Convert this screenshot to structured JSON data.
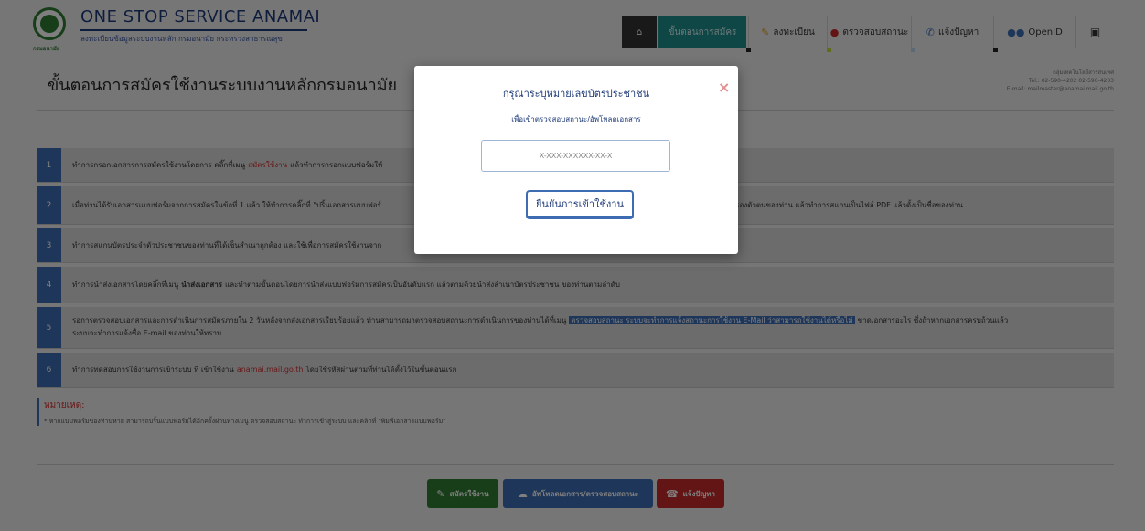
{
  "header": {
    "logo_caption": "กรมอนามัย",
    "title": "ONE STOP SERVICE ANAMAI",
    "subtitle": "ลงทะเบียนข้อมูลระบบงานหลัก กรมอนามัย กระทรวงสาธารณสุข",
    "nav": {
      "home_icon": "home-icon",
      "steps_label": "ขั้นตอนการสมัคร",
      "register_label": "ลงทะเบียน",
      "check_label": "ตรวจสอบสถานะ",
      "report_label": "แจ้งปัญหา",
      "openid_label": "OpenID",
      "lock_icon": "lock-icon"
    },
    "indicator_colors": [
      "#222222",
      "#c5d93a",
      "#b9d4ea",
      "#222222"
    ]
  },
  "page": {
    "title": "ขั้นตอนการสมัครใช้งานระบบงานหลักกรมอนามัย",
    "contact_line1": "กลุ่มเทคโนโลยีสารสนเทศ",
    "contact_line2": "Tel.: 02-590-4202 02-590-4203",
    "contact_line3": "E-mail: mailmaster@anamai.mail.go.th"
  },
  "steps": [
    {
      "num": "1",
      "pre": "ทำการกรอกเอกสารการสมัครใช้งานโดยการ คลิ๊กที่เมนู",
      "hl": "สมัครใช้งาน",
      "post": "แล้วทำการกรอกแบบฟอร์มให้"
    },
    {
      "num": "2",
      "pre": "เมื่อท่านได้รับเอกสารแบบฟอร์มจากการสมัครในข้อที่ 1 แล้ว ให้ทำการคลิ๊กที่ \"ปริ้นเอกสารแบบฟอร์",
      "post": "รเซ็นรับรองตัวตนของท่าน แล้วทำการสแกนเป็นไฟล์ PDF แล้วตั้งเป็นชื่อของท่าน"
    },
    {
      "num": "3",
      "pre": "ทำการสแกนบัตรประจำตัวประชาชนของท่านที่ได้เซ็นสำเนาถูกต้อง และใช้เพื่อการสมัครใช้งานจาก"
    },
    {
      "num": "4",
      "pre": "ทำการนำส่งเอกสารโดยคลิ๊กที่เมนู",
      "hl": "นำส่งเอกสาร",
      "post": "และทำตามขั้นตอนโดยการนำส่งแบบฟอร์มการสมัครเป็นอันดับแรก แล้วตามด้วยนำส่งสำเนาบัตรประชาชน ของท่านตามลำดับ"
    },
    {
      "num": "5",
      "pre": "รอการตรวจสอบเอกสารและการดำเนินการสมัครภายใน 2 วันหลังจากส่งเอกสารเรียบร้อยแล้ว ท่านสามารถมาตรวจสอบสถานะการดำเนินการของท่านได้ที่เมนู",
      "hl": "ตรวจสอบสถานะ ระบบจะทำการแจ้งสถานะการใช้งาน E-Mail ว่าสามารถใช้งานได้หรือไม่",
      "post": "ขาดเอกสารอะไร ซึ่งถ้าหากเอกสารครบถ้วนแล้ว",
      "line2": "ระบบจะทำการแจ้งชื่อ E-mail ของท่านให้ทราบ"
    },
    {
      "num": "6",
      "pre": "ทำการทดสอบการใช้งานการเข้าระบบ ที่ เข้าใช้งาน",
      "hl": "anamai.mail.go.th",
      "post": "โดยใช้รหัสผ่านตามที่ท่านได้ตั้งไว้ในขั้นตอนแรก"
    }
  ],
  "note": {
    "title": "หมายเหตุ:",
    "text": "* หากแบบฟอร์มของท่านหาย สามารถปริ้นแบบฟอร์มได้อีกครั้งผ่านทางเมนู ตรวจสอบสถานะ ทำการเข้าสู่ระบบ และคลิกที่ \"พิมพ์เอกสารแบบฟอร์ม\""
  },
  "footer_buttons": {
    "apply": "สมัครใช้งาน",
    "upload": "อัพโหลดเอกสาร/ตรวจสอบสถานะ",
    "report": "แจ้งปัญหา"
  },
  "modal": {
    "title": "กรุณาระบุหมายเลขบัตรประชาชน",
    "subtitle": "เพื่อเข้าตรวจสอบสถานะ/อัพโหลดเอกสาร",
    "input_placeholder": "X-XXX-XXXXXX-XX-X",
    "input_value": "",
    "confirm_label": "ยืนยันการเข้าใช้งาน",
    "close_symbol": "×"
  }
}
